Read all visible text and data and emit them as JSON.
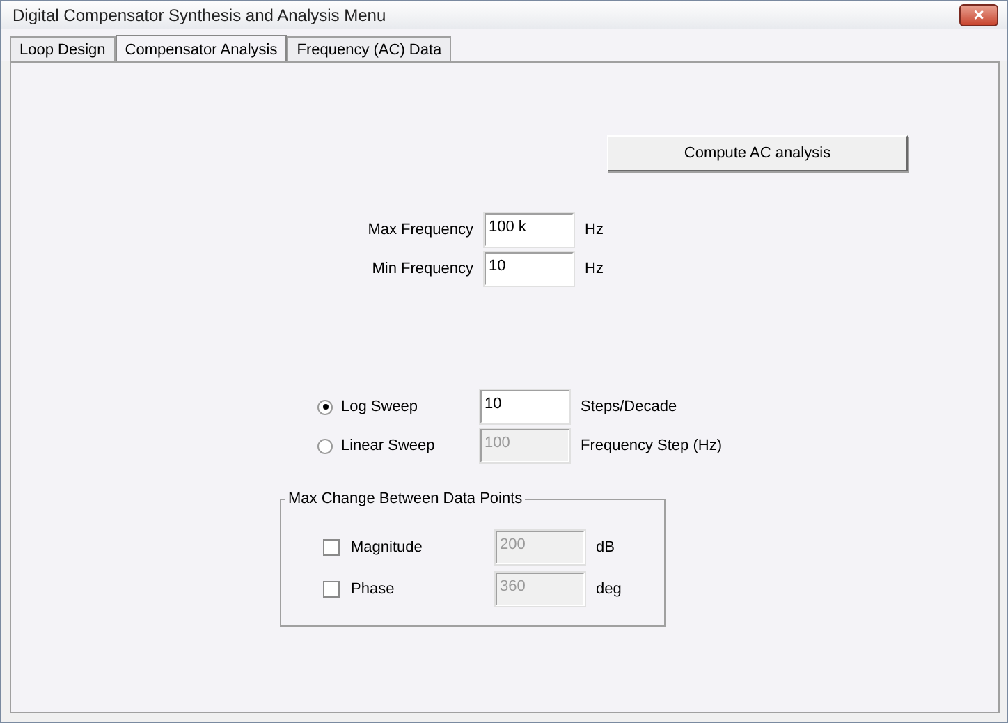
{
  "window": {
    "title": "Digital Compensator Synthesis and Analysis Menu",
    "close": "×"
  },
  "tabs": [
    {
      "label": "Loop Design",
      "selected": false
    },
    {
      "label": "Compensator Analysis",
      "selected": true
    },
    {
      "label": "Frequency (AC) Data",
      "selected": false
    }
  ],
  "compute_button": "Compute AC analysis",
  "frequency_fields": [
    {
      "label": "Max Frequency",
      "value": "100 k",
      "unit": "Hz",
      "disabled": false
    },
    {
      "label": "Min Frequency",
      "value": "10",
      "unit": "Hz",
      "disabled": false
    }
  ],
  "sweep_options": [
    {
      "label": "Log Sweep",
      "selected": true,
      "value": "10",
      "unit": "Steps/Decade",
      "disabled": false
    },
    {
      "label": "Linear Sweep",
      "selected": false,
      "value": "100",
      "unit": "Frequency Step (Hz)",
      "disabled": true
    }
  ],
  "max_change_group": {
    "title": "Max Change Between Data Points",
    "items": [
      {
        "label": "Magnitude",
        "checked": false,
        "value": "200",
        "unit": "dB",
        "disabled": true
      },
      {
        "label": "Phase",
        "checked": false,
        "value": "360",
        "unit": "deg",
        "disabled": true
      }
    ]
  }
}
